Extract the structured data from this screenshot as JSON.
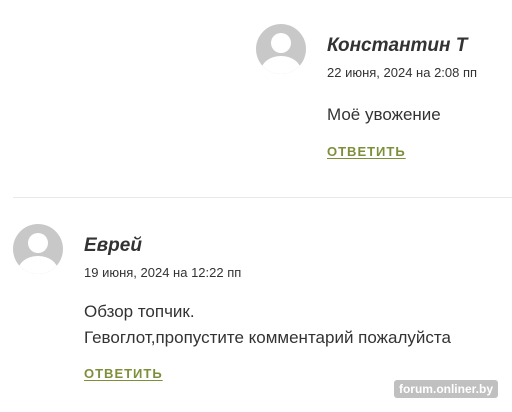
{
  "comments": [
    {
      "author": "Константин Т",
      "date": "22 июня, 2024 на 2:08 пп",
      "text": [
        "Моё увожение"
      ],
      "reply_label": "ОТВЕТИТЬ"
    },
    {
      "author": "Еврей",
      "date": "19 июня, 2024 на 12:22 пп",
      "text": [
        "Обзор топчик.",
        "Гевоглот,пропустите комментарий пожалуйста"
      ],
      "reply_label": "ОТВЕТИТЬ"
    }
  ],
  "watermark": "forum.onliner.by",
  "colors": {
    "link": "#7d8f3a",
    "avatar_bg": "#c8c8c8",
    "text": "#333333"
  }
}
